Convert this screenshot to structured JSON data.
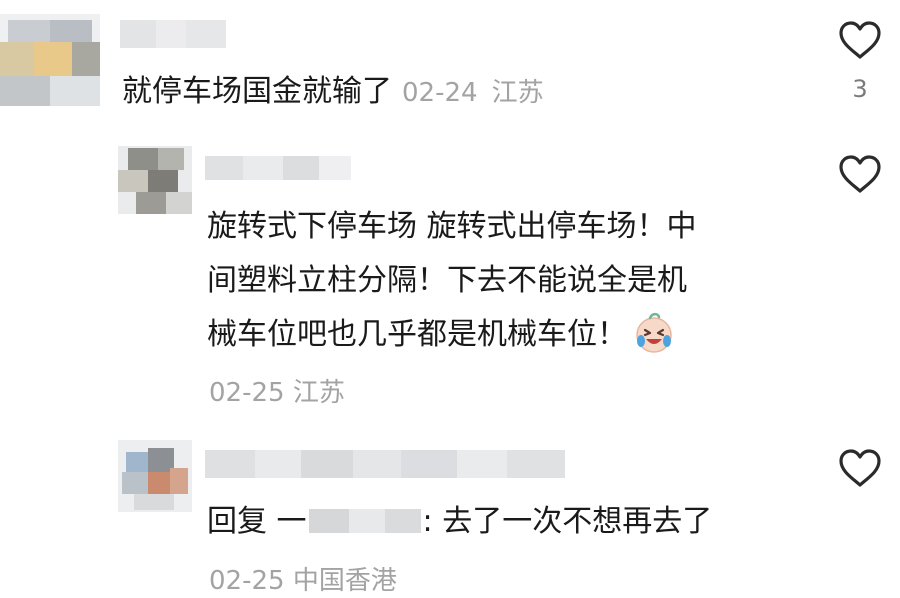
{
  "comments": [
    {
      "text": "就停车场国金就输了",
      "date": "02-24",
      "location": "江苏",
      "like_count": "3"
    },
    {
      "lines": [
        "旋转式下停车场 旋转式出停车场！中",
        "间塑料立柱分隔！下去不能说全是机",
        "械车位吧也几乎都是机械车位！"
      ],
      "emoji": "crying-laughing-emoji",
      "date_location": "02-25 江苏"
    },
    {
      "reply_prefix": "回复 一",
      "reply_text": ": 去了一次不想再去了",
      "date_location": "02-25 中国香港"
    }
  ],
  "icons": {
    "like": "heart-outline-icon"
  },
  "colors": {
    "text": "#1a1a1a",
    "meta": "#a3a3a3",
    "icon": "#2b2b2b"
  }
}
